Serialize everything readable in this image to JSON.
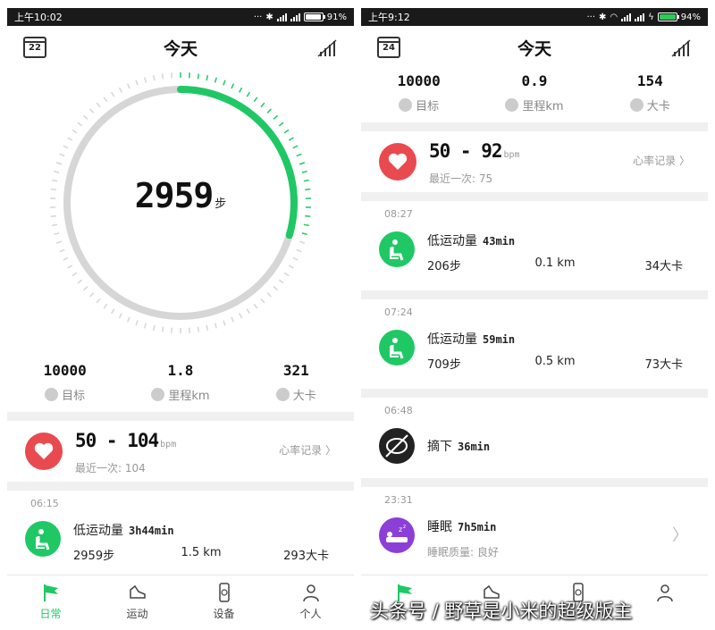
{
  "left": {
    "status": {
      "time": "上午10:02",
      "battery": "91%"
    },
    "header": {
      "title": "今天",
      "date": "22"
    },
    "ring": {
      "steps": "2959",
      "unit": "步",
      "progress": 0.2959
    },
    "stats": [
      {
        "value": "10000",
        "label": "目标"
      },
      {
        "value": "1.8",
        "label": "里程km"
      },
      {
        "value": "321",
        "label": "大卡"
      }
    ],
    "heart": {
      "range": "50 - 104",
      "unit": "bpm",
      "sub": "最近一次: 104",
      "link": "心率记录"
    },
    "activity": {
      "time": "06:15",
      "title": "低运动量",
      "duration": "3h44min",
      "steps": "2959步",
      "distance": "1.5 km",
      "calories": "293大卡"
    },
    "tabs": [
      {
        "label": "日常"
      },
      {
        "label": "运动"
      },
      {
        "label": "设备"
      },
      {
        "label": "个人"
      }
    ]
  },
  "right": {
    "status": {
      "time": "上午9:12",
      "battery": "94%"
    },
    "header": {
      "title": "今天",
      "date": "24"
    },
    "stats": [
      {
        "value": "10000",
        "label": "目标"
      },
      {
        "value": "0.9",
        "label": "里程km"
      },
      {
        "value": "154",
        "label": "大卡"
      }
    ],
    "heart": {
      "range": "50 - 92",
      "unit": "bpm",
      "sub": "最近一次: 75",
      "link": "心率记录"
    },
    "activities": [
      {
        "time": "08:27",
        "title": "低运动量",
        "duration": "43min",
        "steps": "206步",
        "distance": "0.1 km",
        "calories": "34大卡"
      },
      {
        "time": "07:24",
        "title": "低运动量",
        "duration": "59min",
        "steps": "709步",
        "distance": "0.5 km",
        "calories": "73大卡"
      }
    ],
    "offwrist": {
      "time": "06:48",
      "title": "摘下",
      "duration": "36min"
    },
    "sleep": {
      "time": "23:31",
      "title": "睡眠",
      "duration": "7h5min",
      "quality": "睡眠质量: 良好"
    }
  },
  "watermark": "头条号 / 野草是小米的超级版主",
  "colors": {
    "accent": "#1fc865",
    "heart": "#e84a4f",
    "sleep": "#8b3fd6"
  }
}
